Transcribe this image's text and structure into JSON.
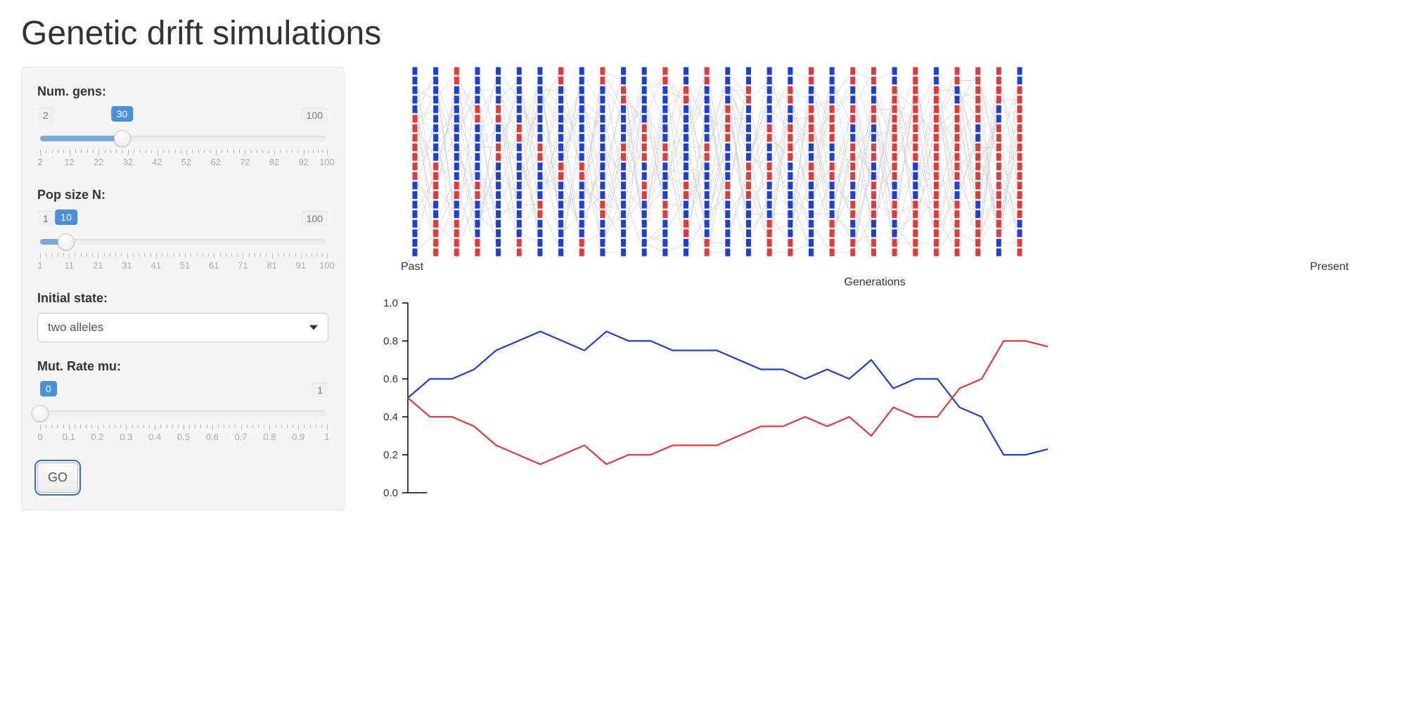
{
  "title": "Genetic drift simulations",
  "sidebar": {
    "num_gens": {
      "label": "Num. gens:",
      "min": 2,
      "max": 100,
      "value": 30,
      "ticks": [
        2,
        12,
        22,
        32,
        42,
        52,
        62,
        72,
        82,
        92,
        100
      ]
    },
    "pop_size": {
      "label": "Pop size N:",
      "min": 1,
      "max": 100,
      "value": 10,
      "ticks": [
        1,
        11,
        21,
        31,
        41,
        51,
        61,
        71,
        81,
        91,
        100
      ]
    },
    "initial_state": {
      "label": "Initial state:",
      "selected": "two alleles"
    },
    "mut_rate": {
      "label": "Mut. Rate mu:",
      "min": 0,
      "max": 1,
      "value": 0,
      "ticks": [
        0,
        0.1,
        0.2,
        0.3,
        0.4,
        0.5,
        0.6,
        0.7,
        0.8,
        0.9,
        1
      ]
    },
    "go_label": "GO"
  },
  "pedigree": {
    "past_label": "Past",
    "present_label": "Present",
    "caption": "Generations",
    "colors": {
      "A": "#1c3fd6",
      "B": "#e03a3a"
    },
    "columns": [
      [
        "A",
        "A",
        "A",
        "A",
        "A",
        "B",
        "B",
        "B",
        "B",
        "B",
        "B",
        "B",
        "A",
        "A",
        "A",
        "A",
        "A",
        "A",
        "A",
        "A"
      ],
      [
        "A",
        "A",
        "A",
        "A",
        "A",
        "A",
        "A",
        "A",
        "A",
        "A",
        "B",
        "B",
        "B",
        "B",
        "A",
        "A",
        "B",
        "B",
        "B",
        "B"
      ],
      [
        "B",
        "B",
        "A",
        "A",
        "A",
        "A",
        "A",
        "A",
        "A",
        "A",
        "A",
        "A",
        "B",
        "B",
        "A",
        "A",
        "B",
        "B",
        "B",
        "B"
      ],
      [
        "A",
        "A",
        "A",
        "A",
        "B",
        "B",
        "A",
        "A",
        "A",
        "A",
        "A",
        "A",
        "B",
        "B",
        "A",
        "A",
        "A",
        "A",
        "B",
        "B"
      ],
      [
        "A",
        "A",
        "A",
        "A",
        "B",
        "B",
        "A",
        "A",
        "B",
        "B",
        "A",
        "A",
        "A",
        "A",
        "A",
        "A",
        "A",
        "A",
        "A",
        "A"
      ],
      [
        "A",
        "A",
        "A",
        "A",
        "A",
        "A",
        "B",
        "B",
        "A",
        "A",
        "A",
        "A",
        "A",
        "A",
        "A",
        "A",
        "A",
        "A",
        "B",
        "B"
      ],
      [
        "A",
        "A",
        "A",
        "A",
        "A",
        "A",
        "A",
        "A",
        "B",
        "B",
        "A",
        "A",
        "A",
        "A",
        "B",
        "B",
        "A",
        "A",
        "A",
        "A"
      ],
      [
        "B",
        "B",
        "A",
        "A",
        "A",
        "A",
        "A",
        "A",
        "A",
        "A",
        "B",
        "B",
        "A",
        "A",
        "A",
        "A",
        "A",
        "A",
        "A",
        "A"
      ],
      [
        "A",
        "A",
        "A",
        "A",
        "A",
        "A",
        "A",
        "A",
        "A",
        "A",
        "B",
        "B",
        "A",
        "A",
        "A",
        "A",
        "A",
        "A",
        "B",
        "B"
      ],
      [
        "B",
        "B",
        "A",
        "A",
        "A",
        "A",
        "A",
        "A",
        "A",
        "A",
        "A",
        "A",
        "A",
        "A",
        "B",
        "B",
        "A",
        "A",
        "A",
        "A"
      ],
      [
        "A",
        "A",
        "B",
        "B",
        "A",
        "A",
        "A",
        "A",
        "B",
        "B",
        "A",
        "A",
        "A",
        "A",
        "A",
        "A",
        "A",
        "A",
        "A",
        "A"
      ],
      [
        "A",
        "A",
        "A",
        "A",
        "A",
        "A",
        "B",
        "B",
        "B",
        "B",
        "A",
        "A",
        "B",
        "B",
        "A",
        "A",
        "A",
        "A",
        "A",
        "A"
      ],
      [
        "B",
        "B",
        "A",
        "A",
        "A",
        "A",
        "A",
        "A",
        "B",
        "B",
        "A",
        "A",
        "A",
        "A",
        "B",
        "B",
        "A",
        "A",
        "A",
        "A"
      ],
      [
        "A",
        "A",
        "B",
        "B",
        "A",
        "A",
        "A",
        "A",
        "A",
        "A",
        "A",
        "A",
        "B",
        "B",
        "A",
        "A",
        "B",
        "B",
        "A",
        "A"
      ],
      [
        "B",
        "B",
        "A",
        "A",
        "A",
        "A",
        "A",
        "A",
        "B",
        "B",
        "A",
        "A",
        "A",
        "A",
        "A",
        "A",
        "A",
        "A",
        "B",
        "B"
      ],
      [
        "A",
        "A",
        "A",
        "A",
        "B",
        "B",
        "B",
        "B",
        "A",
        "A",
        "A",
        "A",
        "B",
        "B",
        "A",
        "A",
        "A",
        "A",
        "A",
        "A"
      ],
      [
        "A",
        "A",
        "B",
        "B",
        "A",
        "A",
        "A",
        "A",
        "A",
        "A",
        "B",
        "B",
        "B",
        "B",
        "A",
        "A",
        "A",
        "A",
        "A",
        "A"
      ],
      [
        "A",
        "A",
        "A",
        "A",
        "A",
        "A",
        "B",
        "B",
        "A",
        "A",
        "B",
        "B",
        "A",
        "A",
        "A",
        "A",
        "B",
        "B",
        "B",
        "B"
      ],
      [
        "A",
        "A",
        "B",
        "B",
        "A",
        "A",
        "B",
        "B",
        "B",
        "B",
        "A",
        "A",
        "A",
        "A",
        "A",
        "A",
        "A",
        "A",
        "B",
        "B"
      ],
      [
        "B",
        "B",
        "A",
        "A",
        "B",
        "B",
        "B",
        "B",
        "A",
        "A",
        "B",
        "B",
        "A",
        "A",
        "A",
        "A",
        "A",
        "A",
        "A",
        "A"
      ],
      [
        "A",
        "A",
        "A",
        "A",
        "B",
        "B",
        "B",
        "B",
        "A",
        "A",
        "B",
        "B",
        "A",
        "A",
        "A",
        "A",
        "B",
        "B",
        "B",
        "B"
      ],
      [
        "B",
        "B",
        "A",
        "A",
        "B",
        "B",
        "A",
        "A",
        "B",
        "B",
        "B",
        "B",
        "A",
        "A",
        "B",
        "B",
        "A",
        "A",
        "B",
        "B"
      ],
      [
        "B",
        "B",
        "A",
        "A",
        "B",
        "B",
        "A",
        "A",
        "B",
        "B",
        "A",
        "A",
        "B",
        "B",
        "B",
        "B",
        "A",
        "A",
        "B",
        "B"
      ],
      [
        "A",
        "A",
        "B",
        "B",
        "B",
        "B",
        "B",
        "B",
        "B",
        "B",
        "B",
        "B",
        "A",
        "A",
        "B",
        "B",
        "A",
        "A",
        "B",
        "B"
      ],
      [
        "B",
        "B",
        "B",
        "B",
        "B",
        "B",
        "B",
        "B",
        "B",
        "B",
        "A",
        "A",
        "A",
        "A",
        "B",
        "B",
        "B",
        "B",
        "B",
        "B"
      ],
      [
        "A",
        "A",
        "B",
        "B",
        "B",
        "B",
        "B",
        "B",
        "B",
        "B",
        "B",
        "B",
        "B",
        "B",
        "B",
        "B",
        "B",
        "B",
        "B",
        "B"
      ],
      [
        "B",
        "B",
        "A",
        "A",
        "B",
        "B",
        "B",
        "B",
        "B",
        "B",
        "B",
        "B",
        "A",
        "A",
        "B",
        "B",
        "B",
        "B",
        "B",
        "B"
      ],
      [
        "B",
        "B",
        "B",
        "B",
        "B",
        "B",
        "A",
        "A",
        "B",
        "B",
        "B",
        "B",
        "B",
        "B",
        "A",
        "A",
        "B",
        "B",
        "B",
        "B"
      ],
      [
        "B",
        "B",
        "B",
        "B",
        "A",
        "A",
        "B",
        "B",
        "B",
        "B",
        "B",
        "B",
        "B",
        "B",
        "B",
        "B",
        "B",
        "B",
        "A",
        "A"
      ],
      [
        "A",
        "A",
        "B",
        "B",
        "B",
        "B",
        "B",
        "B",
        "B",
        "B",
        "B",
        "B",
        "B",
        "B",
        "B",
        "B",
        "A",
        "A",
        "B",
        "B"
      ]
    ]
  },
  "chart_data": {
    "type": "line",
    "xlabel": "",
    "ylabel": "",
    "ylim": [
      0,
      1
    ],
    "y_ticks": [
      0.0,
      0.2,
      0.4,
      0.6,
      0.8,
      1.0
    ],
    "x": [
      1,
      2,
      3,
      4,
      5,
      6,
      7,
      8,
      9,
      10,
      11,
      12,
      13,
      14,
      15,
      16,
      17,
      18,
      19,
      20,
      21,
      22,
      23,
      24,
      25,
      26,
      27,
      28,
      29,
      30
    ],
    "series": [
      {
        "name": "blue",
        "color": "#1c3fd6",
        "values": [
          0.5,
          0.6,
          0.6,
          0.65,
          0.75,
          0.8,
          0.85,
          0.8,
          0.75,
          0.85,
          0.8,
          0.8,
          0.75,
          0.75,
          0.75,
          0.7,
          0.65,
          0.65,
          0.6,
          0.65,
          0.6,
          0.7,
          0.55,
          0.6,
          0.6,
          0.45,
          0.4,
          0.2,
          0.2,
          0.23
        ]
      },
      {
        "name": "red",
        "color": "#e03a3a",
        "values": [
          0.5,
          0.4,
          0.4,
          0.35,
          0.25,
          0.2,
          0.15,
          0.2,
          0.25,
          0.15,
          0.2,
          0.2,
          0.25,
          0.25,
          0.25,
          0.3,
          0.35,
          0.35,
          0.4,
          0.35,
          0.4,
          0.3,
          0.45,
          0.4,
          0.4,
          0.55,
          0.6,
          0.8,
          0.8,
          0.77
        ]
      }
    ]
  }
}
